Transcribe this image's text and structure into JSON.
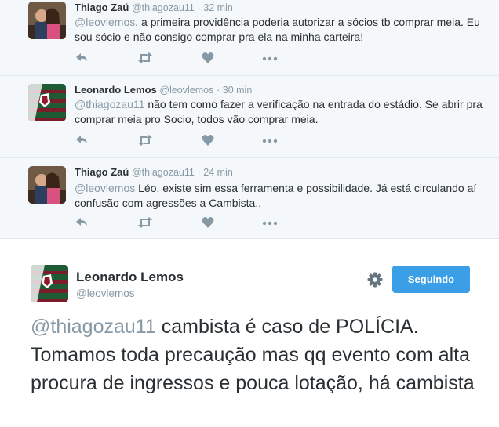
{
  "replies": [
    {
      "avatar": "person-photo",
      "fullname": "Thiago Zaú",
      "username": "@thiagozau11",
      "time": "32 min",
      "mention": "@leovlemos",
      "text": ", a primeira providência poderia autorizar a sócios tb comprar meia. Eu sou sócio e não consigo comprar pra ela na minha carteira!"
    },
    {
      "avatar": "jersey",
      "fullname": "Leonardo Lemos",
      "username": "@leovlemos",
      "time": "30 min",
      "mention": "@thiagozau11",
      "text": " não tem como fazer a verificação na entrada do estádio. Se abrir pra comprar meia pro Socio, todos vão comprar meia."
    },
    {
      "avatar": "person-photo",
      "fullname": "Thiago Zaú",
      "username": "@thiagozau11",
      "time": "24 min",
      "mention": "@leovlemos",
      "text": " Léo, existe sim essa ferramenta e possibilidade. Já está circulando aí confusão com agressões a Cambista.."
    }
  ],
  "separator": "·",
  "main_tweet": {
    "fullname": "Leonardo Lemos",
    "username": "@leovlemos",
    "follow_label": "Seguindo",
    "mention": "@thiagozau11",
    "text": " cambista é caso de POLÍCIA. Tomamos toda precaução mas qq evento com alta procura de ingressos e pouca lotação, há cambista"
  },
  "colors": {
    "accent": "#3a9fe7",
    "muted": "#8899a6",
    "text": "#292f33",
    "reply_bg": "#f5f8fa"
  },
  "icons": [
    "reply-icon",
    "retweet-icon",
    "like-icon",
    "more-icon",
    "gear-icon"
  ]
}
